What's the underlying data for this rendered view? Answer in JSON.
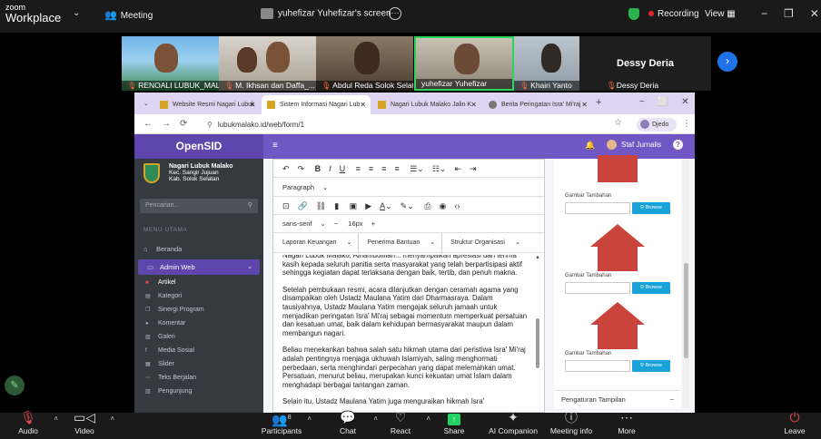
{
  "zoom": {
    "logo_line1": "zoom",
    "logo_line2": "Workplace",
    "meeting_label": "Meeting",
    "share_label": "yuhefizar Yuhefizar's screen",
    "recording_label": "Recording",
    "view_label": "View"
  },
  "participants": [
    {
      "name": "RENOALI LUBUK_MAL..."
    },
    {
      "name": "M. Ikhsan dan Daffa_..."
    },
    {
      "name": "Abdul Reda Solok Selat..."
    },
    {
      "name": "yuhefizar Yuhefizar"
    },
    {
      "name": "Khairi Yanto"
    },
    {
      "name": "Dessy Deria"
    }
  ],
  "browser": {
    "tabs": [
      {
        "label": "Website Resmi Nagari Lubuk"
      },
      {
        "label": "Sistem Informasi Nagari Lub"
      },
      {
        "label": "Nagari Lubuk Malako Jalin K"
      },
      {
        "label": "Berita Peringatan Isra' Mi'raj"
      }
    ],
    "url": "lubukmalako.id/web/form/1",
    "profile_label": "Djedo"
  },
  "app": {
    "brand": "OpenSID",
    "org_line1": "Nagari Lubuk Malako",
    "org_line2": "Kec. Sangir Jujuan",
    "org_line3": "Kab. Solok Selatan",
    "search_placeholder": "Pencarian...",
    "menu_header": "MENU UTAMA",
    "user": "Staf Jurnalis",
    "menu": {
      "beranda": "Beranda",
      "admin_web": "Admin Web"
    },
    "submenu": [
      "Artikel",
      "Kategori",
      "Sinergi Program",
      "Komentar",
      "Galeri",
      "Media Sosial",
      "Slider",
      "Teks Berjalan",
      "Pengunjung"
    ]
  },
  "editor": {
    "format": "Paragraph",
    "font": "sans-serif",
    "size": "16px",
    "dropdowns": [
      "Laporan Keuangan",
      "Penerima Bantuan",
      "Struktur Organisasi"
    ],
    "paragraphs": [
      "Nagari Lubuk Malako, Alhamdulillah... menyampaikan apresiasi dan terima kasih kepada seluruh panitia serta masyarakat yang telah berpartisipasi aktif sehingga kegiatan dapat terlaksana dengan baik, tertib, dan penuh makna.",
      "Setelah pembukaan resmi, acara dilanjutkan dengan ceramah agama yang disampaikan oleh Ustadz Maulana Yatim dari Dharmasraya. Dalam tausiyahnya, Ustadz Maulana Yatim mengajak seluruh jamaah untuk menjadikan peringatan Isra' Mi'raj sebagai momentum memperkuat persatuan dan kesatuan umat, baik dalam kehidupan bermasyarakat maupun dalam membangun nagari.",
      "Beliau menekankan bahwa salah satu hikmah utama dari peristiwa Isra' Mi'raj adalah pentingnya menjaga ukhuwah Islamiyah, saling menghormati perbedaan, serta menghindari perpecahan yang dapat melemahkan umat. Persatuan, menurut beliau, merupakan kunci kekuatan umat Islam dalam menghadapi berbagai tantangan zaman.",
      "Selain itu, Ustadz Maulana Yatim juga menguraikan hikmah Isra'"
    ]
  },
  "right_panel": {
    "gambar_label": "Gambar Tambahan",
    "browse_label": "Browse",
    "settings_label": "Pengaturan Tampilan"
  },
  "toolbar": {
    "audio": "Audio",
    "video": "Video",
    "participants": "Participants",
    "participants_count": "8",
    "chat": "Chat",
    "react": "React",
    "share": "Share",
    "ai": "AI Companion",
    "meeting_info": "Meeting info",
    "more": "More",
    "leave": "Leave"
  },
  "colors": {
    "zoom_bar": "#1a1a1a",
    "opensid_purple": "#7157c3",
    "sidebar_dark": "#343a40",
    "browse_blue": "#1ba3d9",
    "share_green": "#23d160",
    "recording_red": "#e02828"
  }
}
